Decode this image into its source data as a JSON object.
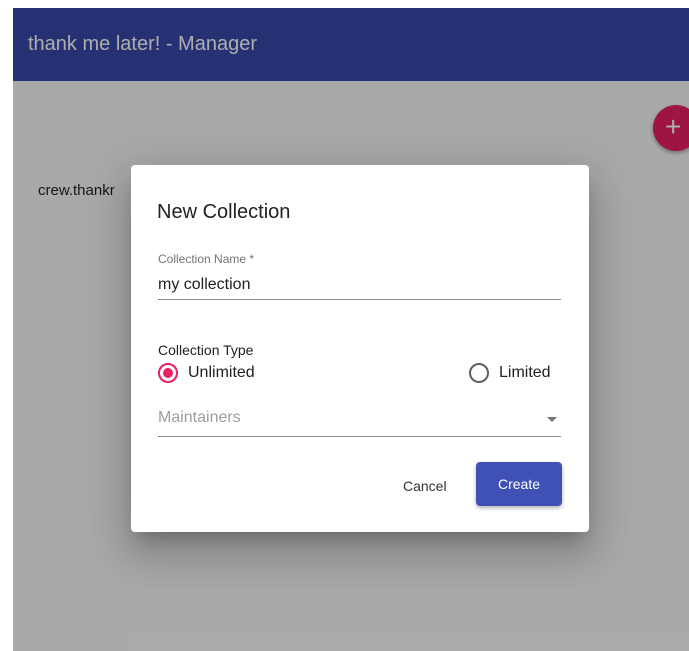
{
  "app": {
    "title": "thank me later! - Manager"
  },
  "main": {
    "collection_link_text": "crew.thankr",
    "fab_symbol": "+"
  },
  "dialog": {
    "title": "New Collection",
    "collection_name_label": "Collection Name *",
    "collection_name_value": "my collection",
    "collection_type_label": "Collection Type",
    "radio_unlimited_label": "Unlimited",
    "radio_limited_label": "Limited",
    "selected_type": "Unlimited",
    "maintainers_placeholder": "Maintainers",
    "cancel_label": "Cancel",
    "create_label": "Create"
  },
  "colors": {
    "app_bar": "#3949ab",
    "primary_button": "#3f51b5",
    "accent": "#e91e63",
    "backdrop": "rgba(0,0,0,0.32)"
  }
}
